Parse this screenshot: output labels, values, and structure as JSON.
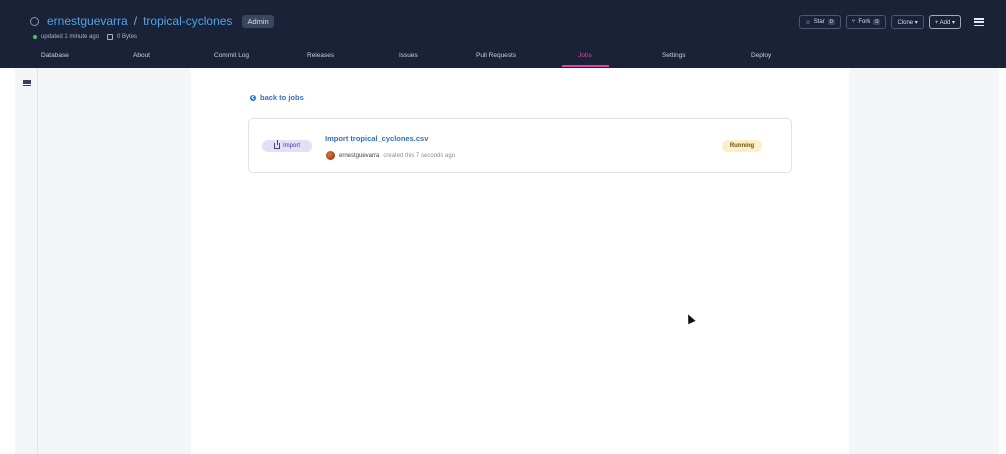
{
  "header": {
    "owner": "ernestguevarra",
    "separator": "/",
    "repo": "tropical-cyclones",
    "role_badge": "Admin",
    "updated": "updated 1 minute ago",
    "size": "0 Bytes",
    "actions": {
      "star_label": "Star",
      "star_count": "0",
      "fork_label": "Fork",
      "fork_count": "0",
      "clone_label": "Clone ▾",
      "add_label": "+ Add ▾"
    }
  },
  "nav": {
    "items": [
      "Database",
      "About",
      "Commit Log",
      "Releases",
      "Issues",
      "Pull Requests",
      "Jobs",
      "Settings",
      "Deploy"
    ],
    "active": "Jobs"
  },
  "main": {
    "back_link": "back to jobs",
    "job": {
      "type_label": "Import",
      "title": "Import tropical_cyclones.csv",
      "user": "ernestguevarra",
      "created_text": "created this 7 seconds ago",
      "status": "Running"
    }
  },
  "colors": {
    "header_bg": "#1a2238",
    "accent": "#e23fa3",
    "link": "#3470c4",
    "running": "#fcefc7",
    "import_badge": "#e4dff7"
  }
}
